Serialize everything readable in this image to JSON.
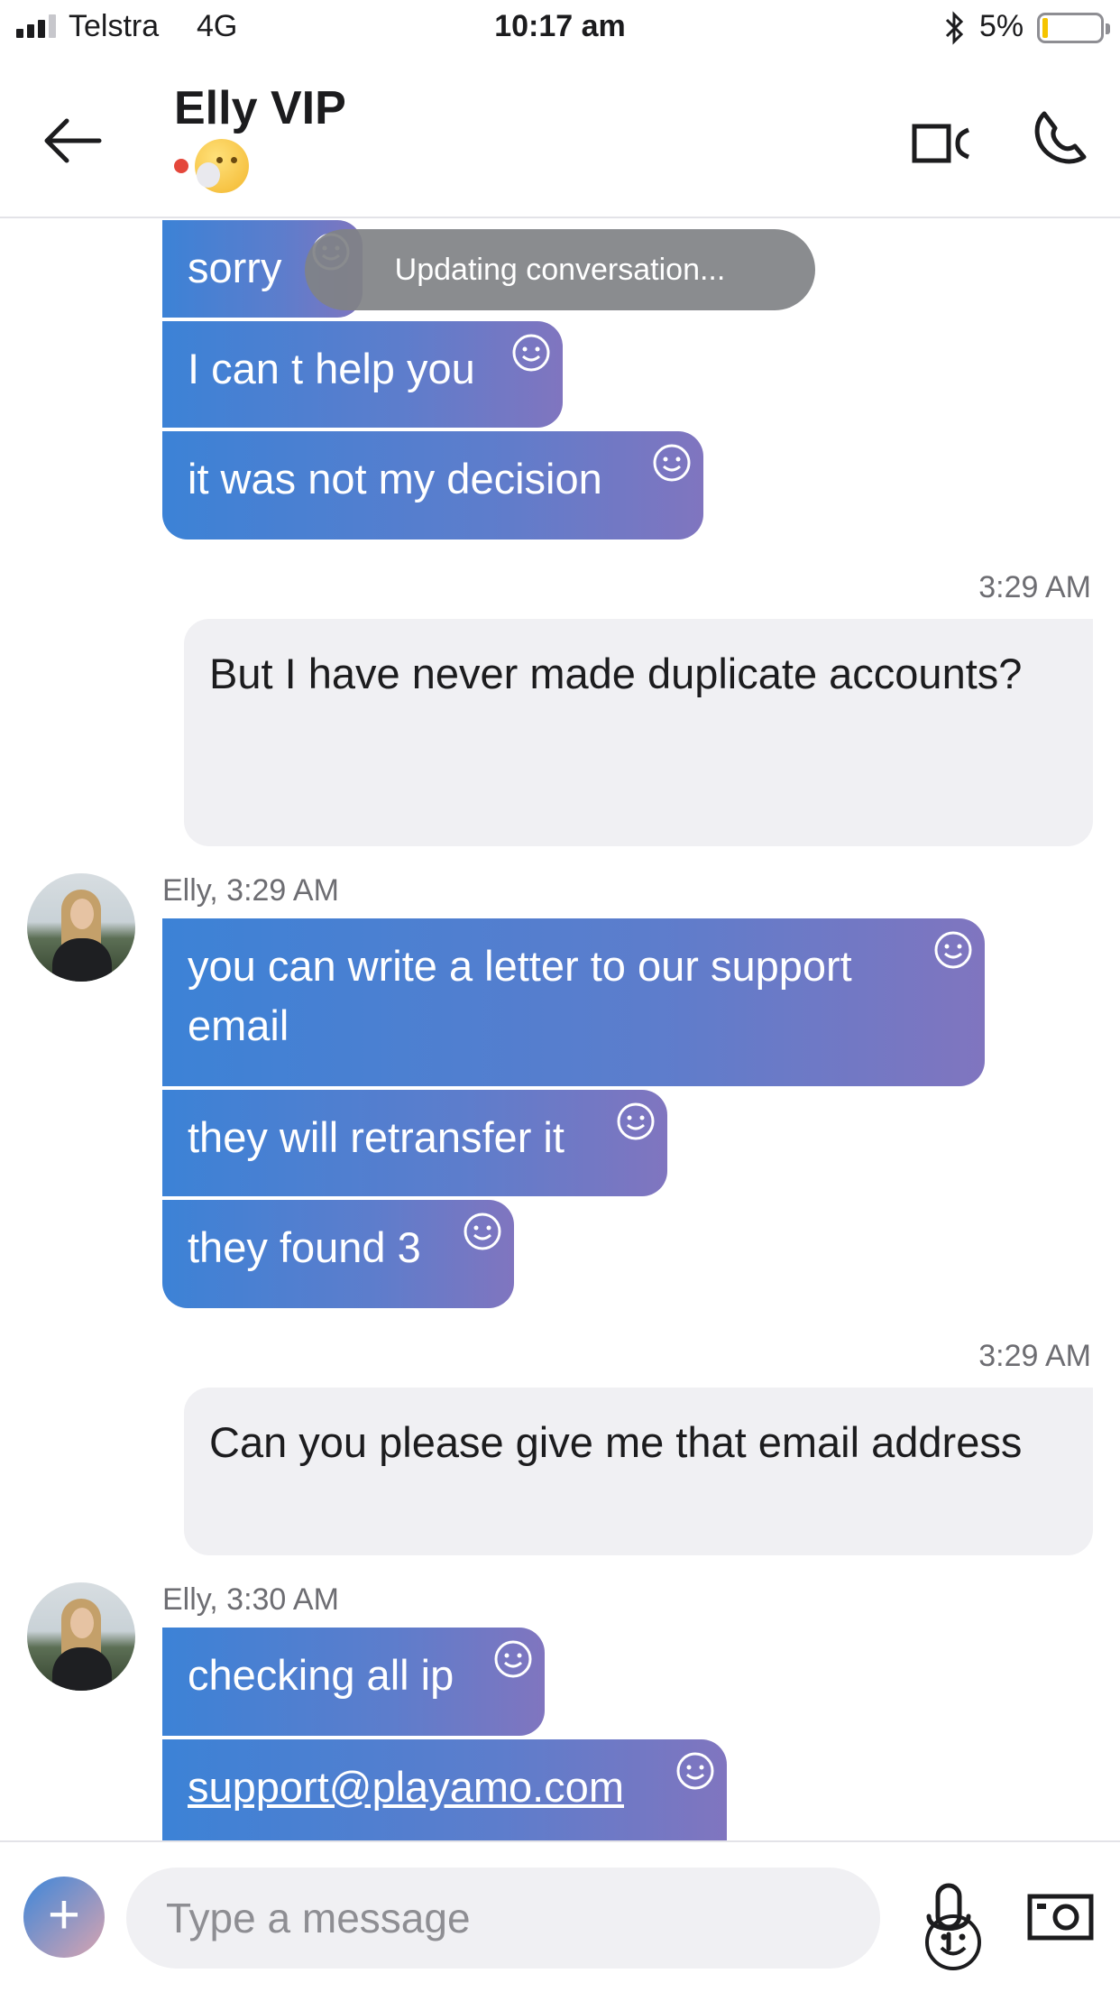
{
  "status_bar": {
    "carrier": "Telstra",
    "network": "4G",
    "time": "10:17 am",
    "battery": "5%",
    "battery_color": "#f5c400"
  },
  "header": {
    "title": "Elly VIP",
    "presence_color": "#e4473b",
    "mood_icon": "hand-over-mouth-emoji-icon"
  },
  "toast": "Updating conversation...",
  "messages": {
    "m1": "sorry",
    "m2": "I can t help you",
    "m3": "it was not my decision",
    "t1": "3:29 AM",
    "o1": "But I have never made duplicate accounts?",
    "s1": "Elly, 3:29 AM",
    "m4": "you can write a letter to our support email",
    "m5": "they will retransfer it",
    "m6": "they found 3",
    "t2": "3:29 AM",
    "o2": "Can you please give me that email address",
    "s2": "Elly, 3:30 AM",
    "m7": "checking all ip",
    "m8": "support@playamo.com"
  },
  "composer": {
    "placeholder": "Type a message"
  },
  "colors": {
    "incoming_start": "#3c82d6",
    "incoming_end": "#8075bf",
    "outgoing_bg": "#f0f0f3"
  }
}
